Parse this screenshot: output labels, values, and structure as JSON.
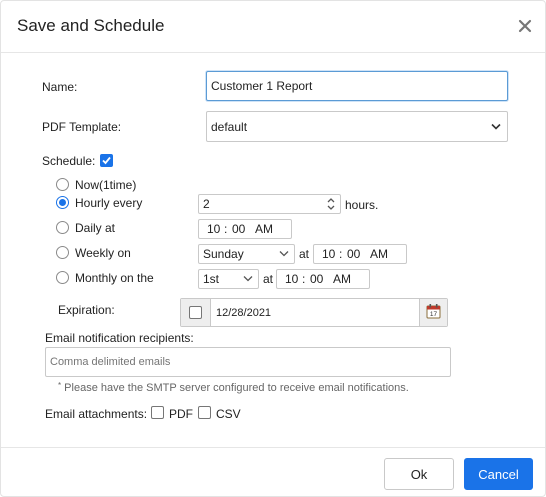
{
  "dialog": {
    "title": "Save and Schedule"
  },
  "form": {
    "name_label": "Name:",
    "name_value": "Customer 1 Report",
    "template_label": "PDF Template:",
    "template_value": "default",
    "schedule_label": "Schedule:",
    "schedule_enabled": true
  },
  "schedule": {
    "now_label": "Now(1time)",
    "hourly_label": "Hourly every",
    "hourly_value": "2",
    "hours_suffix": "hours.",
    "daily_label": "Daily at",
    "daily_hour": "10",
    "daily_min": "00",
    "daily_ampm": "AM",
    "weekly_label": "Weekly on",
    "weekly_day": "Sunday",
    "at_label": "at",
    "weekly_hour": "10",
    "weekly_min": "00",
    "weekly_ampm": "AM",
    "monthly_label": "Monthly on the",
    "monthly_day": "1st",
    "monthly_hour": "10",
    "monthly_min": "00",
    "monthly_ampm": "AM",
    "time_sep": ":",
    "selected": "hourly"
  },
  "expiration": {
    "label": "Expiration:",
    "date_value": "12/28/2021",
    "enabled": false,
    "calendar_icon_text": "17"
  },
  "email": {
    "recipients_label": "Email notification recipients:",
    "recipients_placeholder": "Comma delimited emails",
    "note_marker": "*",
    "note_text": " Please have the SMTP server configured to receive email notifications.",
    "attachments_label": "Email attachments:",
    "pdf_label": "PDF",
    "csv_label": "CSV",
    "pdf_checked": false,
    "csv_checked": false
  },
  "buttons": {
    "ok": "Ok",
    "cancel": "Cancel"
  },
  "colors": {
    "accent": "#1a73e8",
    "border": "#c9c9c9",
    "focus_border": "#5b9bd5"
  }
}
